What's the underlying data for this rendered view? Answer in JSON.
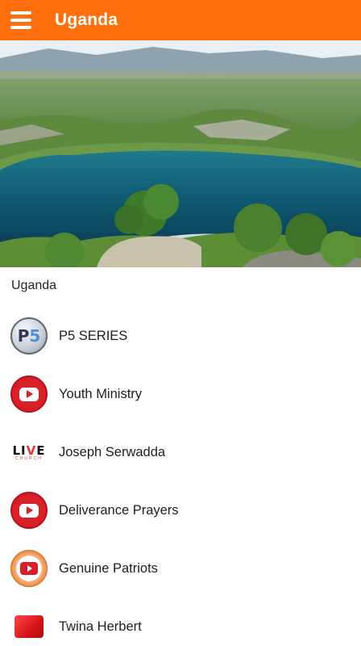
{
  "appbar": {
    "title": "Uganda",
    "background_color": "#ff6f0e",
    "menu_icon": "hamburger-menu-icon"
  },
  "hero": {
    "image": "landscape-photo-crater-lake"
  },
  "section": {
    "title": "Uganda"
  },
  "channels": [
    {
      "label": "P5 SERIES",
      "icon": "p5-logo-icon"
    },
    {
      "label": "Youth Ministry",
      "icon": "youtube-icon"
    },
    {
      "label": "Joseph Serwadda",
      "icon": "live-church-logo-icon"
    },
    {
      "label": "Deliverance Prayers",
      "icon": "youtube-icon"
    },
    {
      "label": "Genuine Patriots",
      "icon": "genuine-patriots-logo-icon"
    },
    {
      "label": "Twina Herbert",
      "icon": "red-square-icon"
    }
  ],
  "logo_text": {
    "live": "LIVE",
    "live_sub": "CHURCH"
  },
  "colors": {
    "accent": "#ff6f0e",
    "youtube_red": "#d61f26",
    "text": "#1e1e1e"
  }
}
